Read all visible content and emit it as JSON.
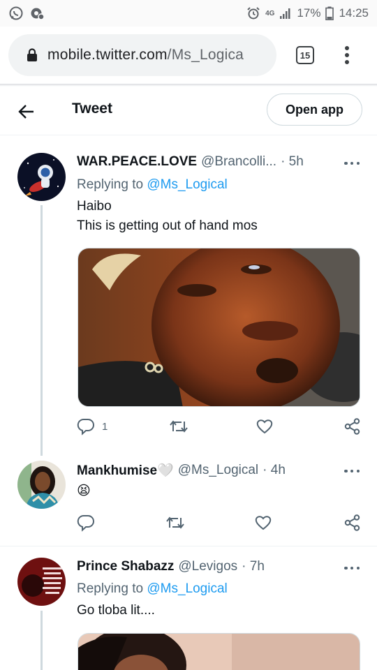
{
  "status_bar": {
    "time": "14:25",
    "battery": "17%",
    "network": "4G",
    "left_icons": [
      "whatsapp-icon",
      "settings-notification-icon"
    ],
    "right_icons": [
      "alarm-icon",
      "signal-icon",
      "battery-icon"
    ]
  },
  "browser": {
    "url_domain": "mobile.twitter.com",
    "url_path": "/Ms_Logica",
    "tab_count": "15"
  },
  "header": {
    "title": "Tweet",
    "open_app": "Open app"
  },
  "tweets": [
    {
      "name": "WAR.PEACE.LOVE",
      "handle": "@Brancolli...",
      "time": "· 5h",
      "replying_prefix": "Replying to",
      "replying_to": "@Ms_Logical",
      "text": "Haibo\nThis is getting out of hand mos",
      "reply_count": "1"
    },
    {
      "name": "Mankhumise🤍",
      "handle": "@Ms_Logical",
      "time": "· 4h",
      "text": "😫"
    },
    {
      "name": "Prince Shabazz",
      "handle": "@Levigos",
      "time": "· 7h",
      "replying_prefix": "Replying to",
      "replying_to": "@Ms_Logical",
      "text": "Go tloba lit...."
    }
  ],
  "colors": {
    "link": "#1d9bf0",
    "secondary_text": "#536471",
    "primary_text": "#0f1419"
  }
}
